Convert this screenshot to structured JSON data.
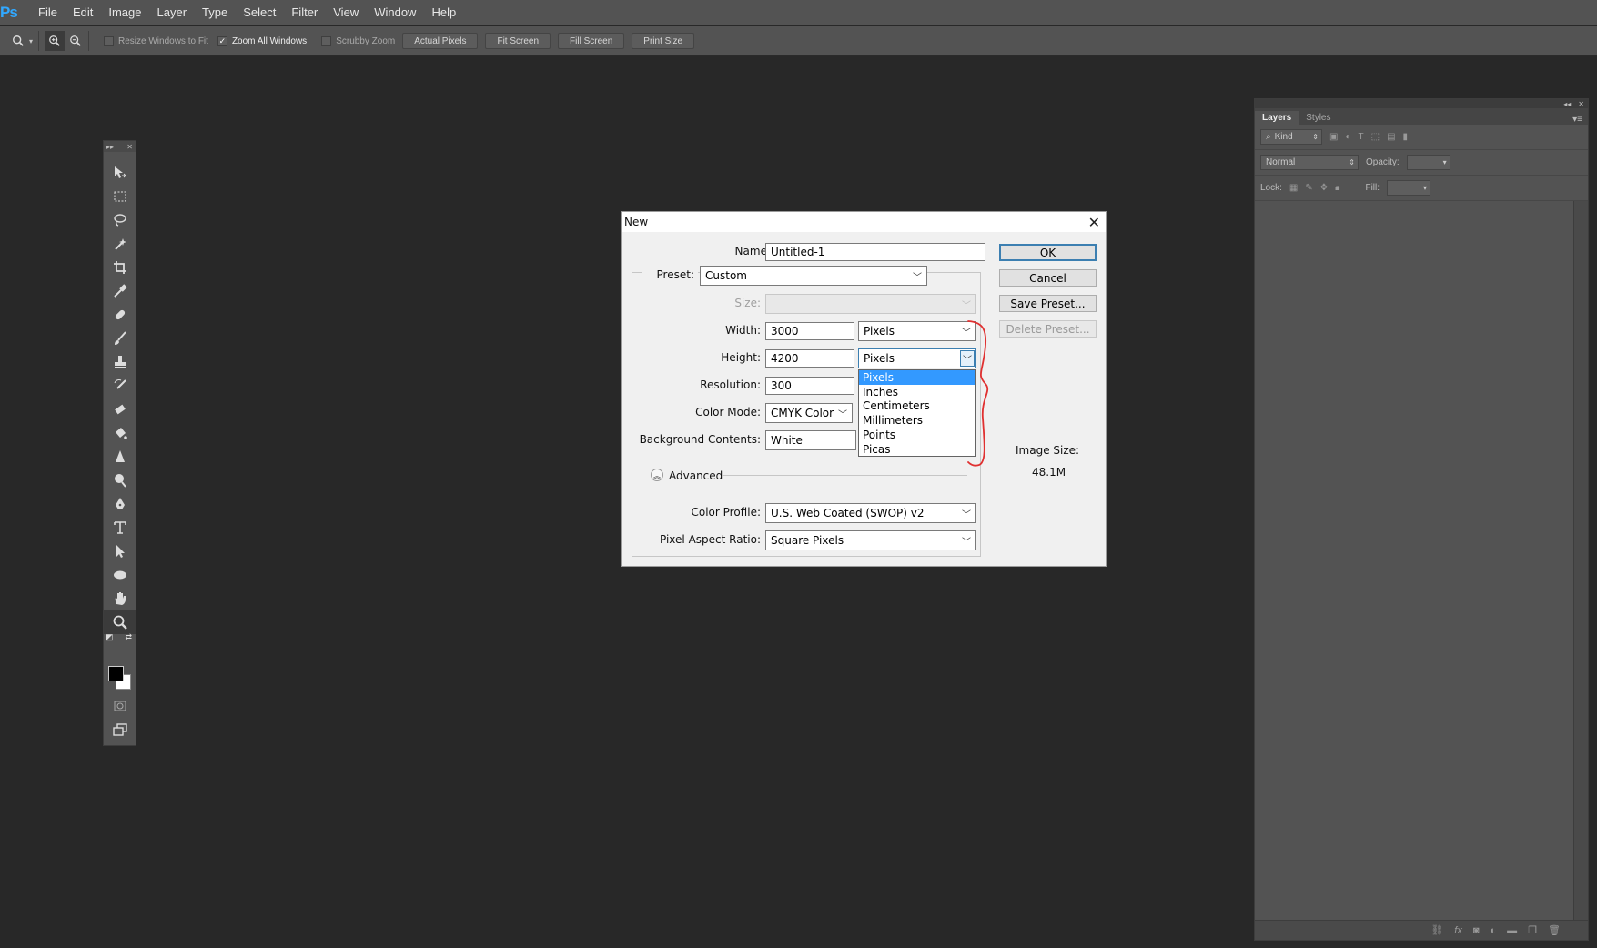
{
  "app": {
    "logo": "Ps"
  },
  "menu": [
    "File",
    "Edit",
    "Image",
    "Layer",
    "Type",
    "Select",
    "Filter",
    "View",
    "Window",
    "Help"
  ],
  "options_bar": {
    "resize_windows_label": "Resize Windows to Fit",
    "resize_windows_checked": false,
    "zoom_all_label": "Zoom All Windows",
    "zoom_all_checked": true,
    "scrubby_zoom_label": "Scrubby Zoom",
    "scrubby_zoom_checked": false,
    "buttons": [
      "Actual Pixels",
      "Fit Screen",
      "Fill Screen",
      "Print Size"
    ]
  },
  "layers_panel": {
    "tabs": [
      "Layers",
      "Styles"
    ],
    "kind_label": "Kind",
    "blend_mode": "Normal",
    "opacity_label": "Opacity:",
    "lock_label": "Lock:",
    "fill_label": "Fill:"
  },
  "dialog": {
    "title": "New",
    "name_label": "Name:",
    "name_value": "Untitled-1",
    "preset_label": "Preset:",
    "preset_value": "Custom",
    "size_label": "Size:",
    "width_label": "Width:",
    "width_value": "3000",
    "width_unit": "Pixels",
    "height_label": "Height:",
    "height_value": "4200",
    "height_unit": "Pixels",
    "resolution_label": "Resolution:",
    "resolution_value": "300",
    "color_mode_label": "Color Mode:",
    "color_mode_value": "CMYK Color",
    "background_label": "Background Contents:",
    "background_value": "White",
    "advanced_label": "Advanced",
    "color_profile_label": "Color Profile:",
    "color_profile_value": "U.S. Web Coated (SWOP) v2",
    "pixel_aspect_label": "Pixel Aspect Ratio:",
    "pixel_aspect_value": "Square Pixels",
    "buttons": {
      "ok": "OK",
      "cancel": "Cancel",
      "save_preset": "Save Preset...",
      "delete_preset": "Delete Preset..."
    },
    "image_size_label": "Image Size:",
    "image_size_value": "48.1M",
    "unit_dropdown_options": [
      "Pixels",
      "Inches",
      "Centimeters",
      "Millimeters",
      "Points",
      "Picas"
    ],
    "unit_dropdown_selected": "Pixels"
  },
  "colors": {
    "accent": "#3399ff",
    "annotation": "#e03030",
    "ok_border": "#3c7fb1"
  }
}
